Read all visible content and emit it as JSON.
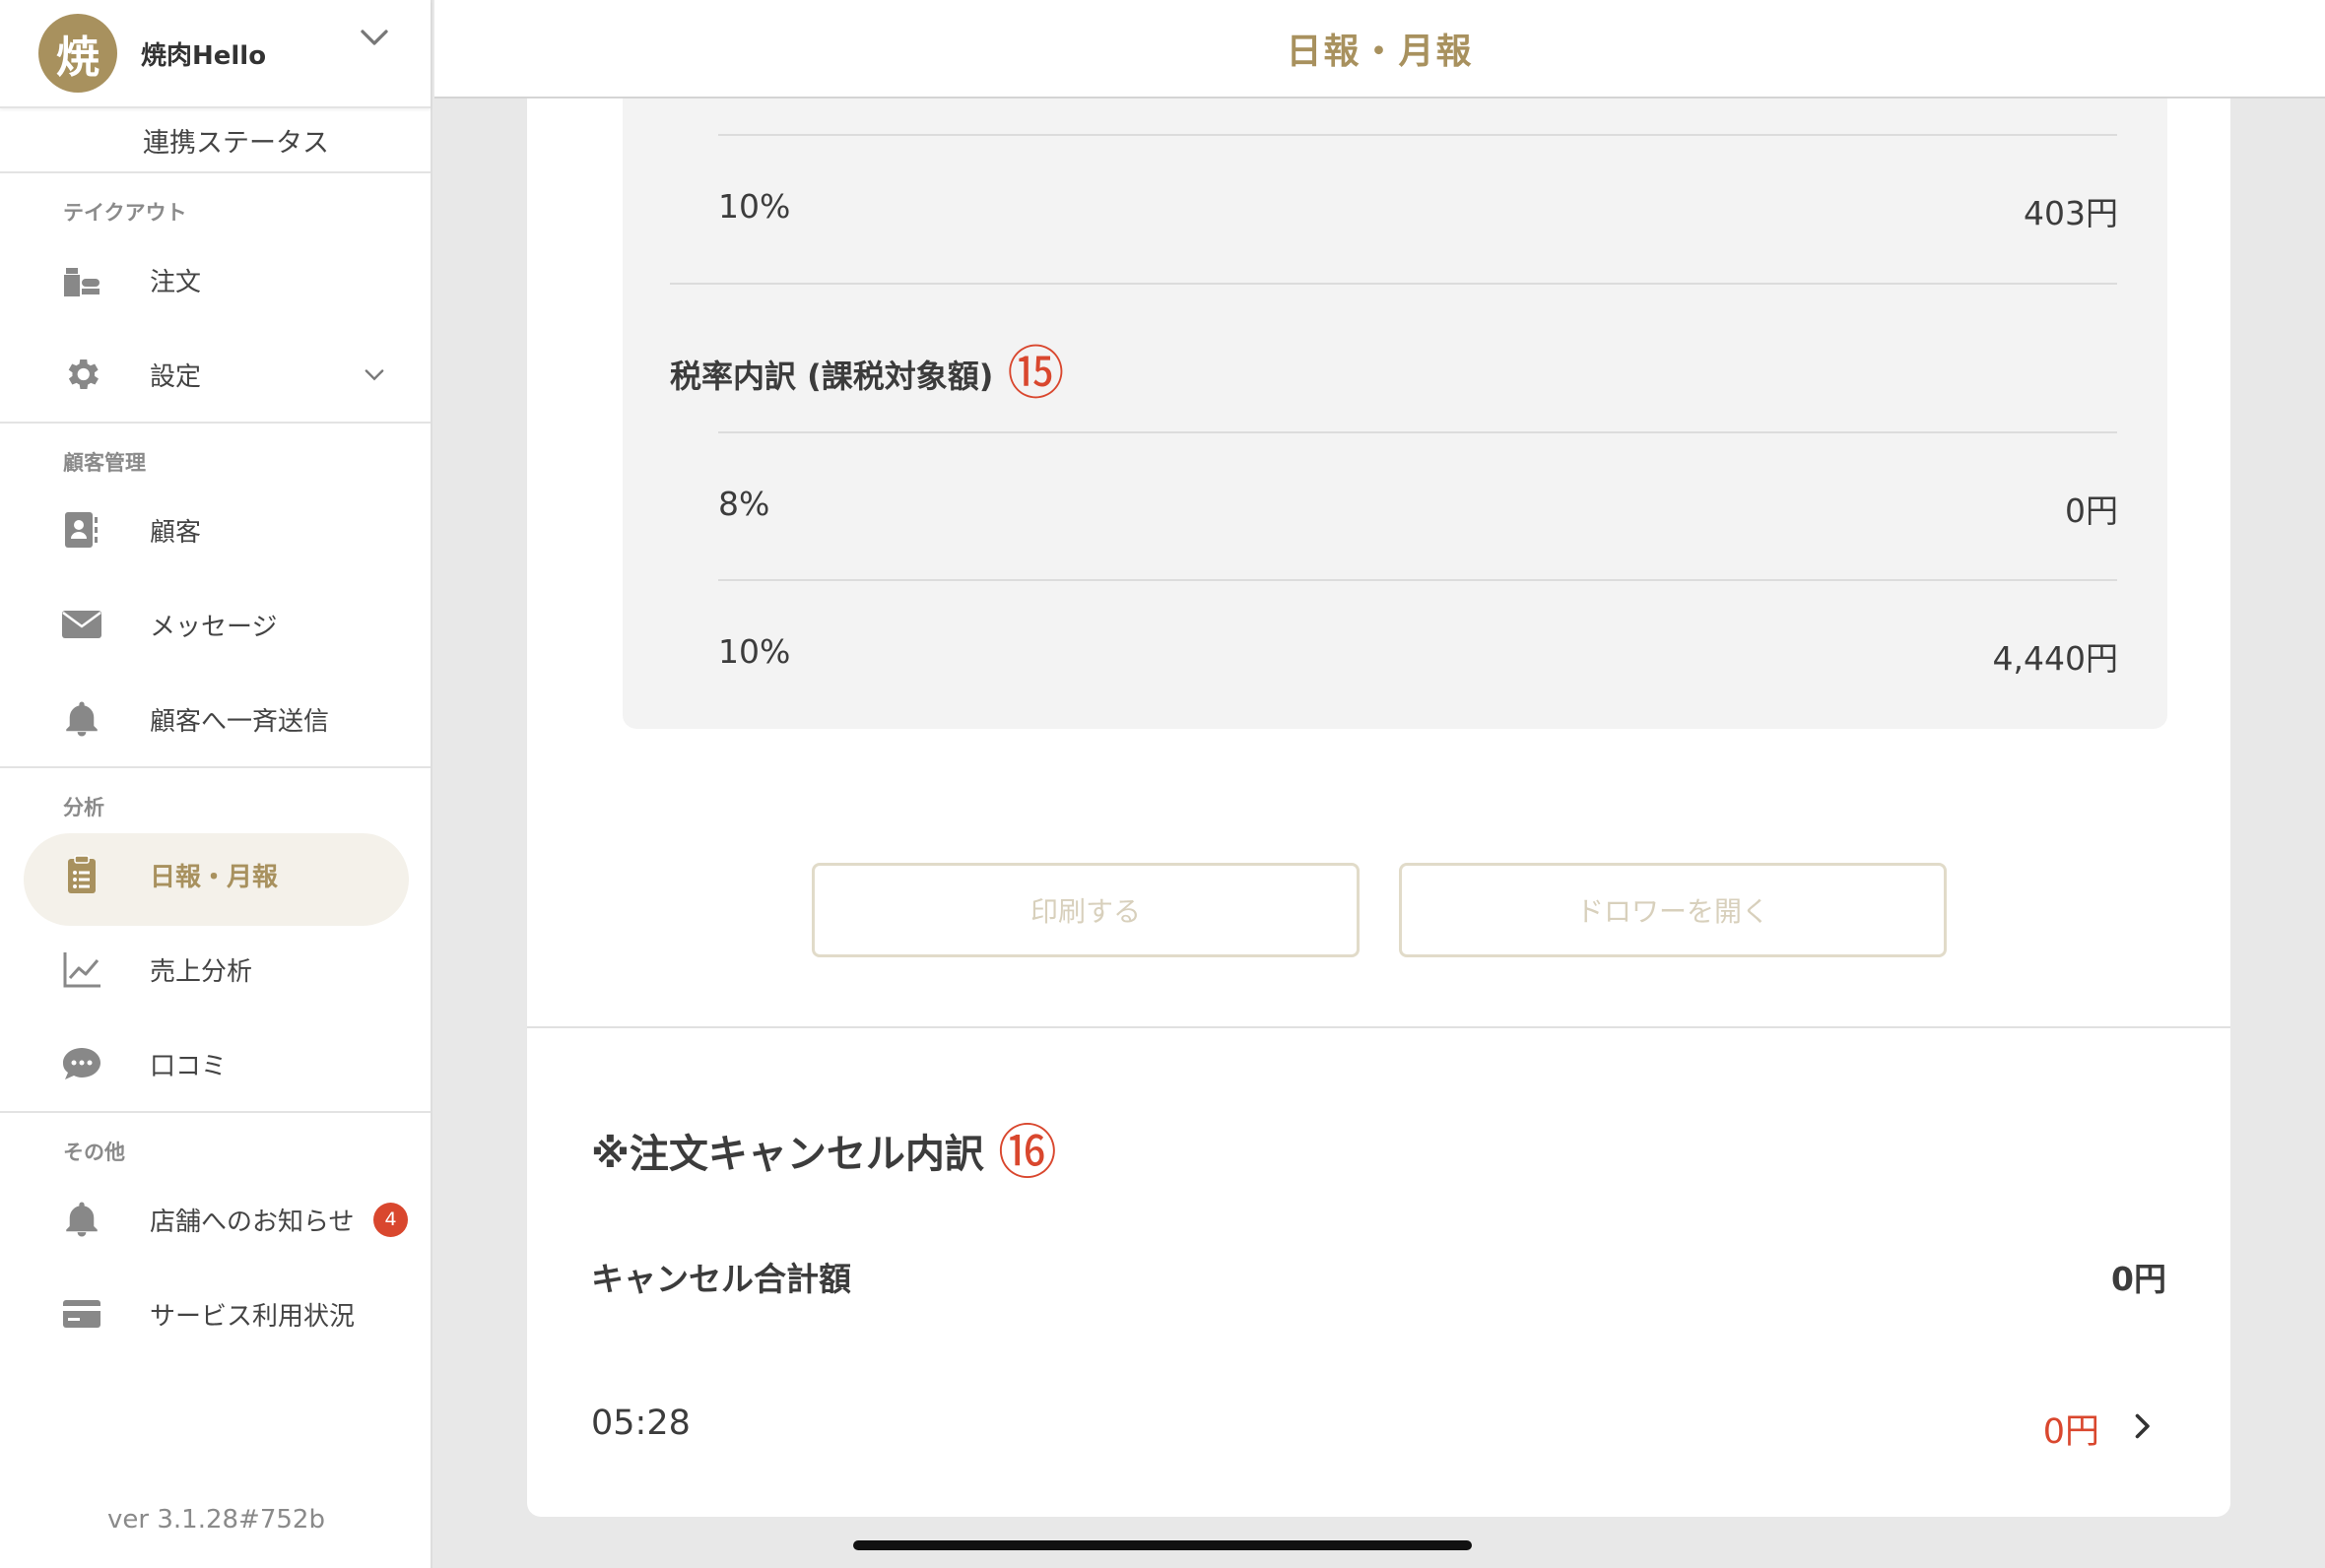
{
  "sidebar": {
    "store": {
      "avatar_char": "焼",
      "name": "焼肉Hello"
    },
    "link_status": "連携ステータス",
    "sections": {
      "takeout": {
        "title": "テイクアウト",
        "order": "注文",
        "settings": "設定"
      },
      "customer": {
        "title": "顧客管理",
        "customers": "顧客",
        "messages": "メッセージ",
        "broadcast": "顧客へ一斉送信"
      },
      "analytics": {
        "title": "分析",
        "daily_monthly": "日報・月報",
        "sales": "売上分析",
        "reviews": "口コミ"
      },
      "other": {
        "title": "その他",
        "notices": "店舗へのお知らせ",
        "notices_badge": "4",
        "service_usage": "サービス利用状況"
      }
    },
    "version": "ver 3.1.28#752b"
  },
  "header": {
    "title": "日報・月報"
  },
  "tax_section": {
    "top_row": {
      "rate": "10%",
      "amount": "403円"
    },
    "breakdown_title": "税率内訳 (課税対象額)",
    "breakdown_marker": "⑮",
    "rows": [
      {
        "rate": "8%",
        "amount": "0円"
      },
      {
        "rate": "10%",
        "amount": "4,440円"
      }
    ]
  },
  "buttons": {
    "print": "印刷する",
    "open_drawer": "ドロワーを開く"
  },
  "cancel_section": {
    "title": "※注文キャンセル内訳",
    "marker": "⑯",
    "total_label": "キャンセル合計額",
    "total_value": "0円",
    "entries": [
      {
        "time": "05:28",
        "amount": "0円"
      }
    ]
  },
  "colors": {
    "accent": "#a8915e",
    "alert": "#d9472e",
    "badge": "#d9472e"
  }
}
